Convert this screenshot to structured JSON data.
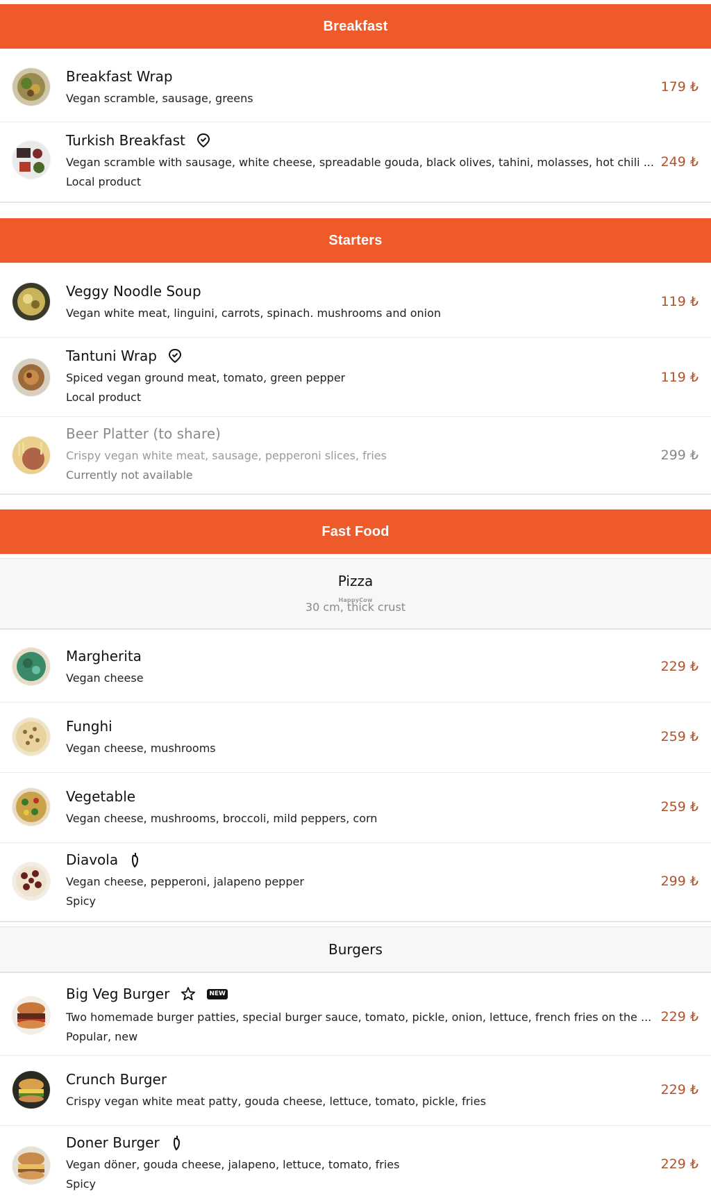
{
  "colors": {
    "accent": "#ef5a2b",
    "price": "#b0532a"
  },
  "sections": {
    "breakfast": "Breakfast",
    "starters": "Starters",
    "fastfood": "Fast Food"
  },
  "subsections": {
    "pizza": {
      "title": "Pizza",
      "note": "30 cm, thick crust",
      "watermark": "HappyCow"
    },
    "burgers": {
      "title": "Burgers"
    }
  },
  "items": {
    "breakfast_wrap": {
      "name": "Breakfast Wrap",
      "desc": "Vegan scramble, sausage, greens",
      "price": "179 ₺"
    },
    "turkish_breakfast": {
      "name": "Turkish Breakfast",
      "desc": "Vegan scramble with sausage, white cheese, spreadable gouda, black olives, tahini, molasses, hot chili ...",
      "tag": "Local product",
      "price": "249 ₺",
      "icon": "location-pin-icon"
    },
    "veggy_noodle_soup": {
      "name": "Veggy Noodle Soup",
      "desc": "Vegan white meat, linguini, carrots, spinach. mushrooms and onion",
      "price": "119 ₺"
    },
    "tantuni_wrap": {
      "name": "Tantuni Wrap",
      "desc": "Spiced vegan ground meat, tomato, green pepper",
      "tag": "Local product",
      "price": "119 ₺",
      "icon": "location-pin-icon"
    },
    "beer_platter": {
      "name": "Beer Platter (to share)",
      "desc": "Crispy vegan white meat, sausage, pepperoni slices, fries",
      "tag": "Currently not available",
      "price": "299 ₺"
    },
    "margherita": {
      "name": "Margherita",
      "desc": "Vegan cheese",
      "price": "229 ₺"
    },
    "funghi": {
      "name": "Funghi",
      "desc": "Vegan cheese, mushrooms",
      "price": "259 ₺"
    },
    "vegetable": {
      "name": "Vegetable",
      "desc": "Vegan cheese, mushrooms, broccoli, mild peppers, corn",
      "price": "259 ₺"
    },
    "diavola": {
      "name": "Diavola",
      "desc": "Vegan cheese, pepperoni, jalapeno pepper",
      "tag": "Spicy",
      "price": "299 ₺",
      "icon": "chili-pepper-icon"
    },
    "big_veg_burger": {
      "name": "Big Veg Burger",
      "desc": "Two homemade burger patties, special burger sauce, tomato, pickle, onion, lettuce, french fries on the ...",
      "tag": "Popular, new",
      "price": "229 ₺",
      "badge": "NEW",
      "icon": "star-icon"
    },
    "crunch_burger": {
      "name": "Crunch Burger",
      "desc": "Crispy vegan white meat patty, gouda cheese, lettuce, tomato, pickle, fries",
      "price": "229 ₺"
    },
    "doner_burger": {
      "name": "Doner Burger",
      "desc": "Vegan döner, gouda cheese, jalapeno, lettuce, tomato, fries",
      "tag": "Spicy",
      "price": "229 ₺",
      "icon": "chili-pepper-icon"
    }
  }
}
